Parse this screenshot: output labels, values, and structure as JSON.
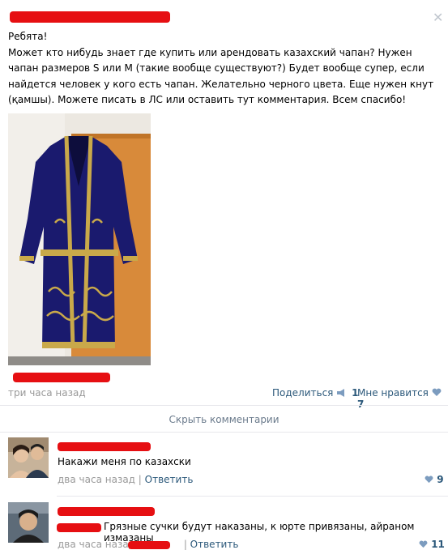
{
  "post": {
    "greeting": "Ребята!",
    "body": "Может кто нибудь знает где купить или арендовать казахский чапан? Нужен чапан размеров S или M (такие вообще существуют?) Будет вообще супер, если найдется человек у кого есть чапан. Желательно черного цвета. Еще нужен кнут (қамшы). Можете писать в ЛС или оставить тут комментария. Всем спасибо!",
    "time": "три часа назад",
    "share_label": "Поделиться",
    "share_count": "1",
    "like_label": "Мне нравится",
    "like_count": "7",
    "close_glyph": "✕"
  },
  "hide_comments_label": "Скрыть комментарии",
  "comments": [
    {
      "text": "Накажи меня по казахски",
      "time": "два часа назад",
      "reply_label": "Ответить",
      "like_count": "9"
    },
    {
      "text": "Грязные сучки будут наказаны, к юрте привязаны, айраном измазаны",
      "time": "два часа назад",
      "reply_label": "Ответить",
      "like_count": "11"
    }
  ],
  "colors": {
    "link": "#2b587a",
    "muted": "#999999",
    "redaction": "#e60f12",
    "robe": "#1a1a6e",
    "gold": "#c9a94a"
  },
  "icons": {
    "share": "megaphone-icon",
    "like": "heart-icon",
    "close": "close-icon"
  }
}
